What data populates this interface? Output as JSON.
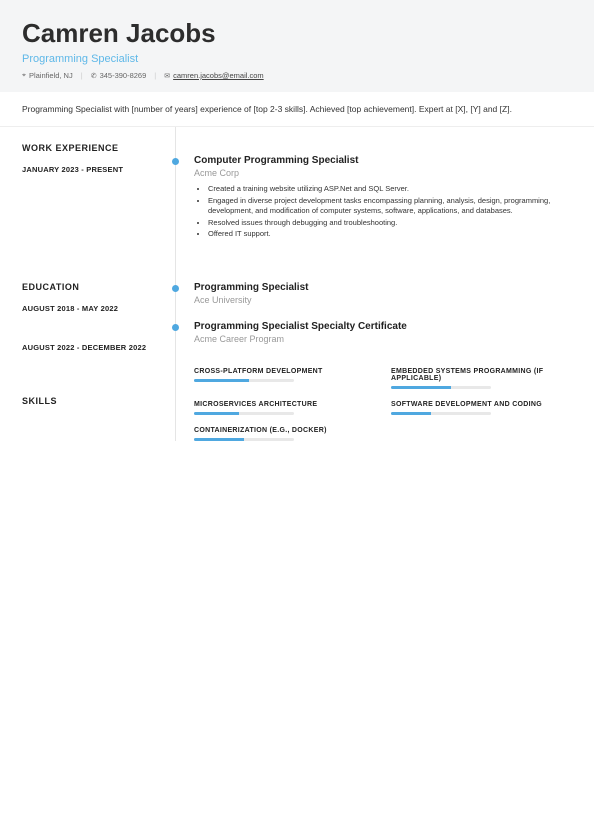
{
  "header": {
    "name": "Camren Jacobs",
    "title": "Programming Specialist",
    "location": "Plainfield, NJ",
    "phone": "345-390-8269",
    "email": "camren.jacobs@email.com"
  },
  "summary": "Programming Specialist with [number of years] experience of [top 2-3 skills]. Achieved [top achievement]. Expert at [X], [Y] and [Z].",
  "sections": {
    "work_heading": "WORK EXPERIENCE",
    "education_heading": "EDUCATION",
    "skills_heading": "SKILLS"
  },
  "work": [
    {
      "dates": "JANUARY 2023 - PRESENT",
      "title": "Computer Programming Specialist",
      "company": "Acme Corp",
      "bullets": [
        "Created a training website utilizing ASP.Net and SQL Server.",
        "Engaged in diverse project development tasks encompassing planning, analysis, design, programming, development, and modification of computer systems, software, applications, and databases.",
        "Resolved issues through debugging and troubleshooting.",
        "Offered IT support."
      ]
    }
  ],
  "education": [
    {
      "dates": "AUGUST 2018 - MAY 2022",
      "title": "Programming Specialist",
      "school": "Ace University"
    },
    {
      "dates": "AUGUST 2022 - DECEMBER 2022",
      "title": "Programming Specialist Specialty Certificate",
      "school": "Acme Career Program"
    }
  ],
  "skills": [
    {
      "name": "CROSS-PLATFORM DEVELOPMENT",
      "fill": "w1"
    },
    {
      "name": "EMBEDDED SYSTEMS PROGRAMMING (IF APPLICABLE)",
      "fill": "w2"
    },
    {
      "name": "MICROSERVICES ARCHITECTURE",
      "fill": "w3"
    },
    {
      "name": "SOFTWARE DEVELOPMENT AND CODING",
      "fill": "w4"
    },
    {
      "name": "CONTAINERIZATION (E.G., DOCKER)",
      "fill": "w5"
    }
  ]
}
